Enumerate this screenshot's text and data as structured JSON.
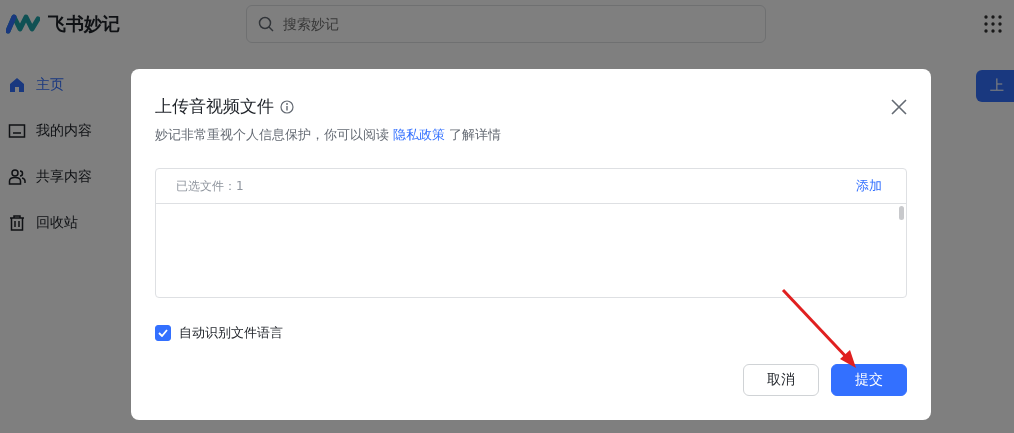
{
  "app": {
    "name": "飞书妙记"
  },
  "search": {
    "placeholder": "搜索妙记"
  },
  "sidebar": {
    "items": [
      {
        "label": "主页",
        "selected": true
      },
      {
        "label": "我的内容",
        "selected": false
      },
      {
        "label": "共享内容",
        "selected": false
      },
      {
        "label": "回收站",
        "selected": false
      }
    ]
  },
  "main": {
    "upload_button": "上"
  },
  "dialog": {
    "title": "上传音视频文件",
    "notice_before": "妙记非常重视个人信息保护，你可以阅读",
    "notice_link": "隐私政策",
    "notice_after": "了解详情",
    "files_label": "已选文件：1",
    "add_link": "添加",
    "auto_detect": {
      "label": "自动识别文件语言",
      "checked": true
    },
    "buttons": [
      {
        "label": "取消",
        "kind": "secondary"
      },
      {
        "label": "提交",
        "kind": "primary"
      }
    ]
  }
}
